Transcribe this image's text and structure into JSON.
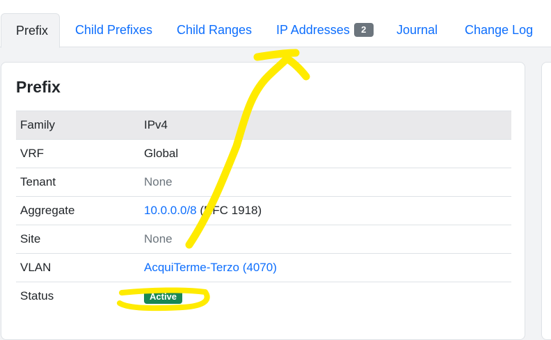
{
  "tabs": [
    {
      "label": "Prefix",
      "active": true
    },
    {
      "label": "Child Prefixes"
    },
    {
      "label": "Child Ranges"
    },
    {
      "label": "IP Addresses",
      "badge": "2"
    },
    {
      "label": "Journal"
    },
    {
      "label": "Change Log"
    }
  ],
  "card": {
    "title": "Prefix",
    "rows": [
      {
        "key": "Family",
        "value": "IPv4"
      },
      {
        "key": "VRF",
        "value": "Global"
      },
      {
        "key": "Tenant",
        "value": "None"
      },
      {
        "key": "Aggregate",
        "link": "10.0.0.0/8",
        "suffix": " (RFC 1918)"
      },
      {
        "key": "Site",
        "value": "None"
      },
      {
        "key": "VLAN",
        "link": "AcquiTerme-Terzo (4070)"
      },
      {
        "key": "Status",
        "badge": "Active"
      }
    ]
  },
  "colors": {
    "link": "#0d6efd",
    "status_active": "#198754",
    "annotation": "#ffeb00"
  }
}
